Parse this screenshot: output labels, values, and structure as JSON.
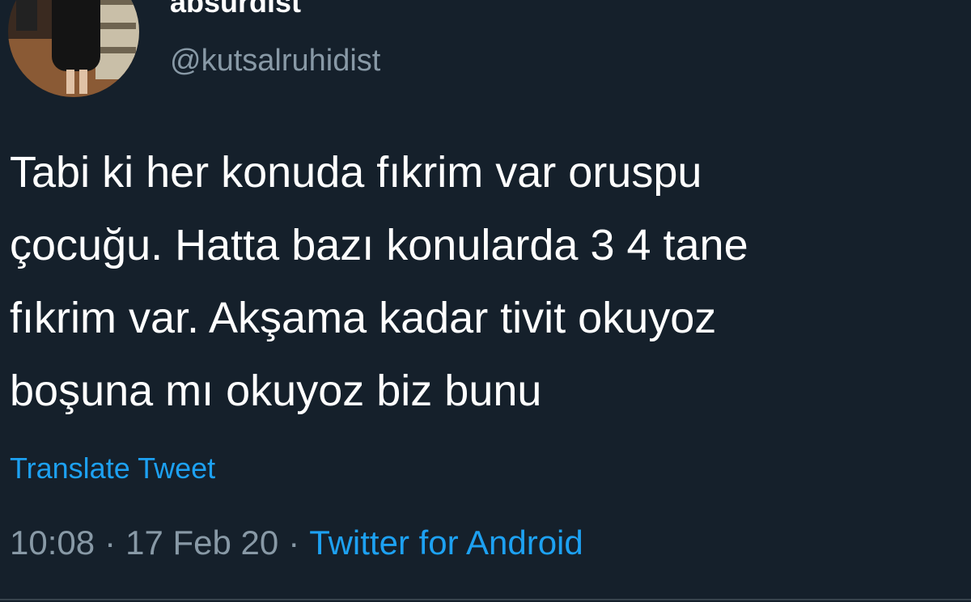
{
  "user": {
    "display_name": "absurdist",
    "handle": "@kutsalruhidist"
  },
  "tweet": {
    "lines": [
      "Tabi ki her konuda fıkrim var oruspu",
      "çocuğu. Hatta bazı konularda 3 4 tane",
      "fıkrim var. Akşama kadar tivit okuyoz",
      "boşuna mı okuyoz biz bunu"
    ],
    "translate_label": "Translate Tweet",
    "time": "10:08",
    "separator": "·",
    "date": "17 Feb 20",
    "source": "Twitter for Android"
  },
  "theme": {
    "background": "#15202b",
    "text": "#ffffff",
    "secondary_text": "#8899a6",
    "link": "#1da1f2"
  }
}
